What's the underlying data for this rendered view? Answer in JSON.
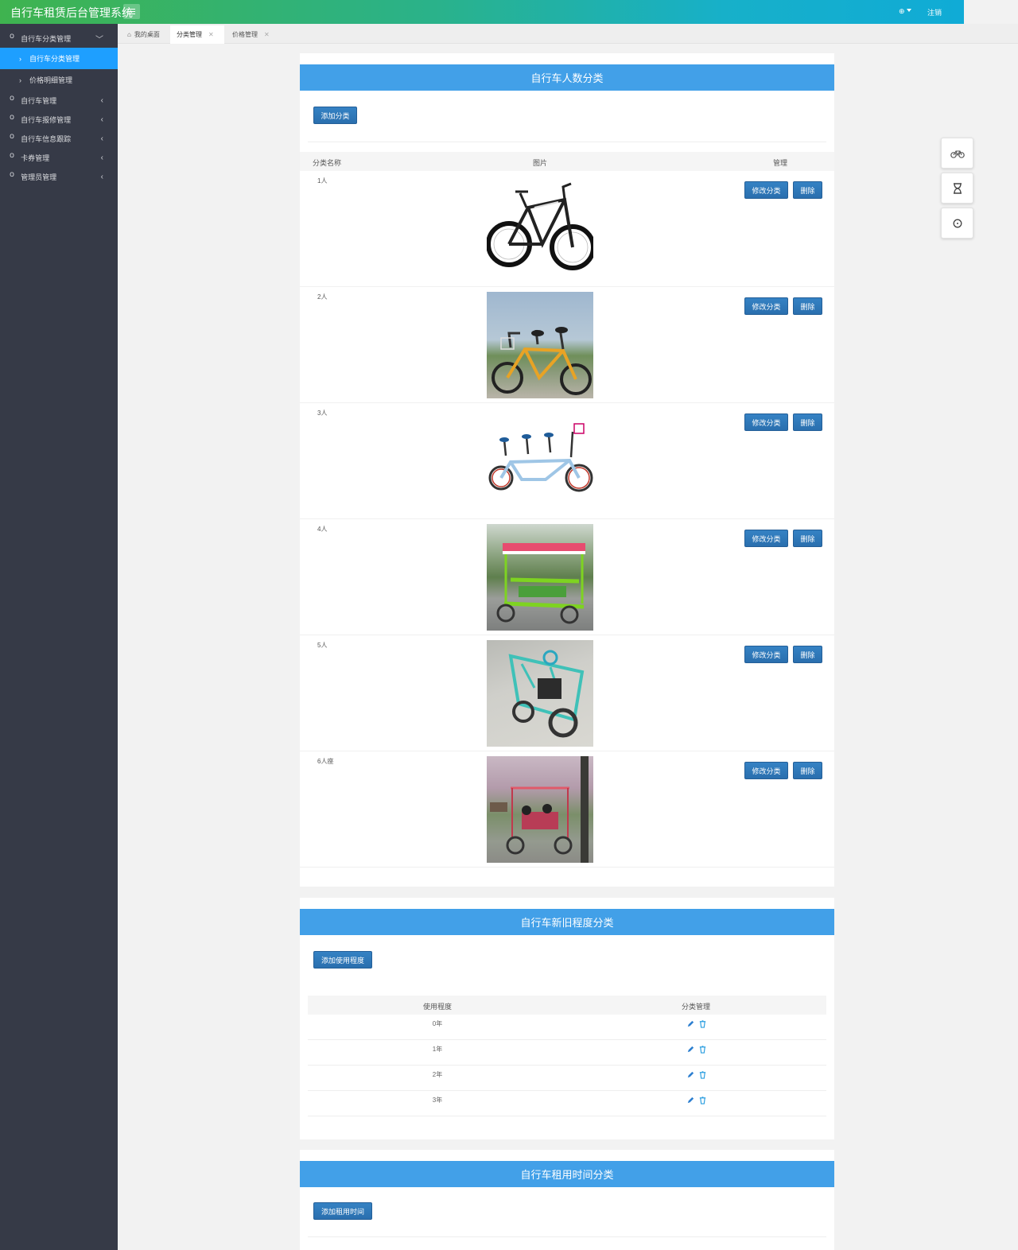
{
  "header": {
    "brand": "自行车租赁后台管理系统",
    "user_label": "⊕",
    "logout": "注销"
  },
  "sidebar": {
    "items": [
      {
        "label": "自行车分类管理",
        "expanded": true,
        "children": [
          {
            "label": "自行车分类管理",
            "active": true
          },
          {
            "label": "价格明细管理",
            "active": false
          }
        ]
      },
      {
        "label": "自行车管理"
      },
      {
        "label": "自行车报修管理"
      },
      {
        "label": "自行车信息跟踪"
      },
      {
        "label": "卡券管理"
      },
      {
        "label": "管理员管理"
      }
    ]
  },
  "tabs": [
    {
      "label": "我的桌面",
      "active": false
    },
    {
      "label": "分类管理",
      "active": true
    },
    {
      "label": "价格管理",
      "active": false
    }
  ],
  "section1": {
    "title": "自行车人数分类",
    "add_button": "添加分类",
    "columns": {
      "name": "分类名称",
      "image": "图片",
      "manage": "管理"
    },
    "edit_label": "修改分类",
    "delete_label": "删除",
    "rows": [
      {
        "name": "1人"
      },
      {
        "name": "2人"
      },
      {
        "name": "3人"
      },
      {
        "name": "4人"
      },
      {
        "name": "5人"
      },
      {
        "name": "6人座"
      }
    ]
  },
  "section2": {
    "title": "自行车新旧程度分类",
    "add_button": "添加使用程度",
    "columns": {
      "level": "使用程度",
      "manage": "分类管理"
    },
    "rows": [
      {
        "level": "0年"
      },
      {
        "level": "1年"
      },
      {
        "level": "2年"
      },
      {
        "level": "3年"
      }
    ]
  },
  "section3": {
    "title": "自行车租用时间分类",
    "add_button": "添加租用时间"
  },
  "colors": {
    "accent": "#1e9fff",
    "card_header": "#42a0e8",
    "button": "#2a6fae",
    "sidebar": "#363a47"
  }
}
